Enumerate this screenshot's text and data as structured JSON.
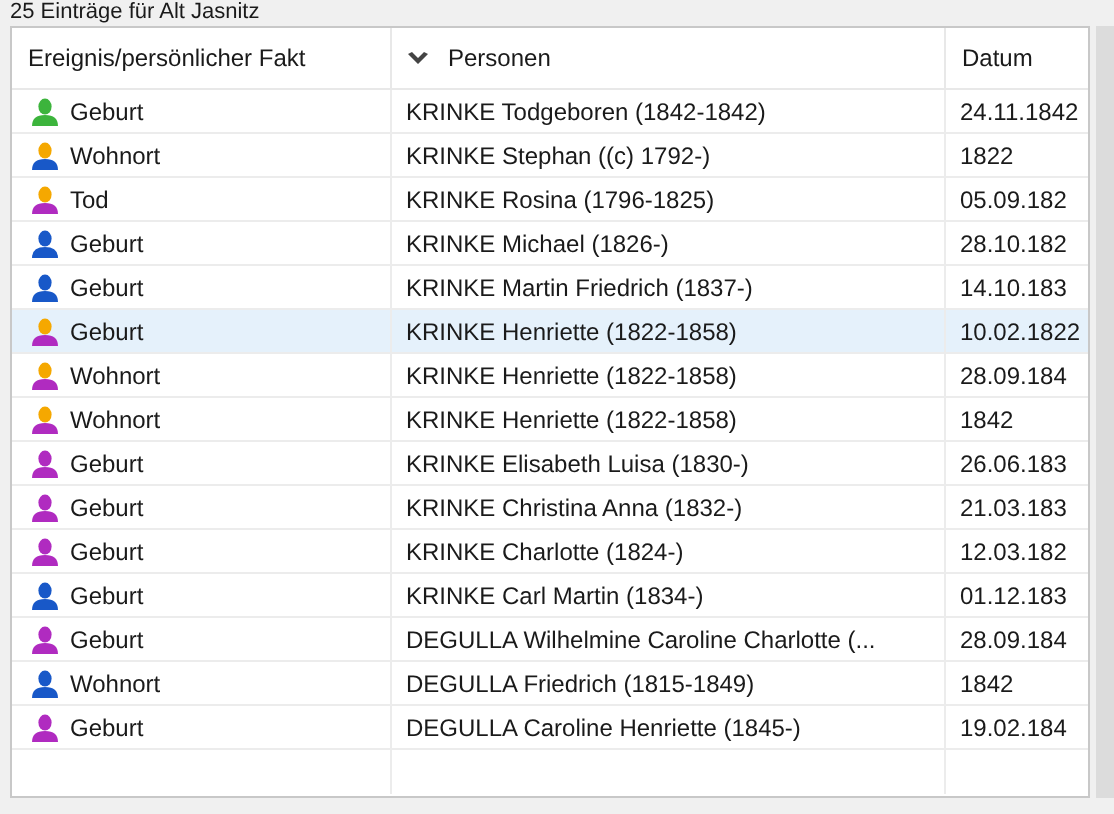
{
  "caption": "25 Einträge für Alt Jasnitz",
  "table": {
    "columns": [
      {
        "label": "Ereignis/persönlicher Fakt",
        "sorted": false
      },
      {
        "label": "Personen",
        "sorted": true
      },
      {
        "label": "Datum",
        "sorted": false
      }
    ],
    "rows": [
      {
        "kind": "unknown",
        "marked": false,
        "selected": false,
        "cells": [
          "Geburt",
          "KRINKE Todgeboren (1842-1842)",
          "24.11.1842"
        ]
      },
      {
        "kind": "male",
        "marked": true,
        "selected": false,
        "cells": [
          "Wohnort",
          "KRINKE Stephan ((c) 1792-)",
          "1822"
        ]
      },
      {
        "kind": "female",
        "marked": true,
        "selected": false,
        "cells": [
          "Tod",
          "KRINKE Rosina (1796-1825)",
          "05.09.182"
        ]
      },
      {
        "kind": "male",
        "marked": false,
        "selected": false,
        "cells": [
          "Geburt",
          "KRINKE Michael (1826-)",
          "28.10.182"
        ]
      },
      {
        "kind": "male",
        "marked": false,
        "selected": false,
        "cells": [
          "Geburt",
          "KRINKE Martin Friedrich (1837-)",
          "14.10.183"
        ]
      },
      {
        "kind": "female",
        "marked": true,
        "selected": true,
        "cells": [
          "Geburt",
          "KRINKE Henriette (1822-1858)",
          "10.02.1822"
        ]
      },
      {
        "kind": "female",
        "marked": true,
        "selected": false,
        "cells": [
          "Wohnort",
          "KRINKE Henriette (1822-1858)",
          "28.09.184"
        ]
      },
      {
        "kind": "female",
        "marked": true,
        "selected": false,
        "cells": [
          "Wohnort",
          "KRINKE Henriette (1822-1858)",
          "1842"
        ]
      },
      {
        "kind": "female",
        "marked": false,
        "selected": false,
        "cells": [
          "Geburt",
          "KRINKE Elisabeth Luisa (1830-)",
          "26.06.183"
        ]
      },
      {
        "kind": "female",
        "marked": false,
        "selected": false,
        "cells": [
          "Geburt",
          "KRINKE Christina Anna (1832-)",
          "21.03.183"
        ]
      },
      {
        "kind": "female",
        "marked": false,
        "selected": false,
        "cells": [
          "Geburt",
          "KRINKE Charlotte (1824-)",
          "12.03.182"
        ]
      },
      {
        "kind": "male",
        "marked": false,
        "selected": false,
        "cells": [
          "Geburt",
          "KRINKE Carl Martin (1834-)",
          "01.12.183"
        ]
      },
      {
        "kind": "female",
        "marked": false,
        "selected": false,
        "cells": [
          "Geburt",
          "DEGULLA Wilhelmine Caroline Charlotte (...",
          "28.09.184"
        ]
      },
      {
        "kind": "male",
        "marked": false,
        "selected": false,
        "cells": [
          "Wohnort",
          "DEGULLA Friedrich (1815-1849)",
          "1842"
        ]
      },
      {
        "kind": "female",
        "marked": false,
        "selected": false,
        "cells": [
          "Geburt",
          "DEGULLA Caroline Henriette (1845-)",
          "19.02.184"
        ]
      }
    ]
  }
}
